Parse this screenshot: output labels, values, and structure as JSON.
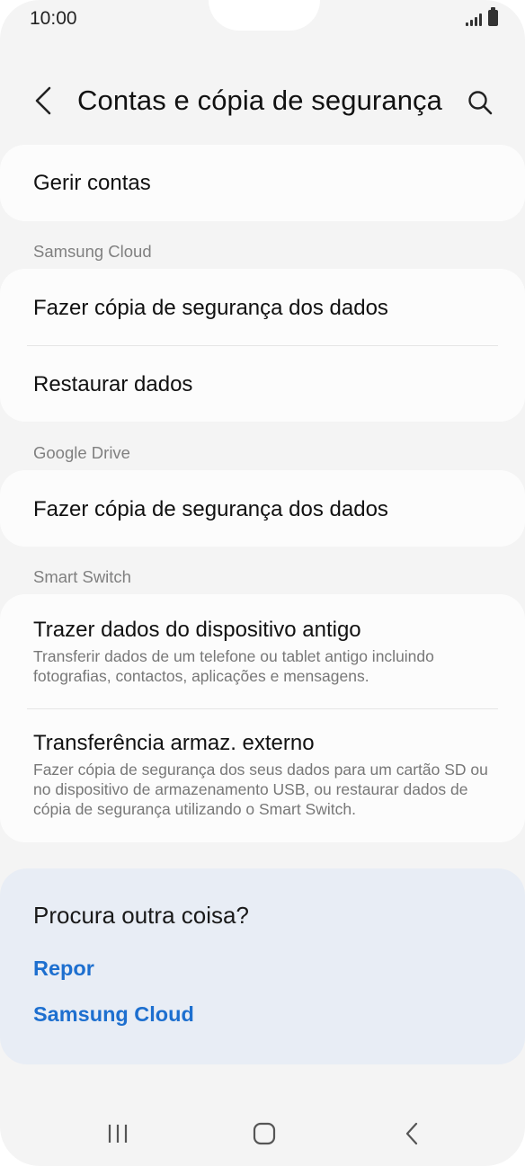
{
  "status_bar": {
    "time": "10:00"
  },
  "header": {
    "title": "Contas e cópia de segurança"
  },
  "accounts": {
    "manage_label": "Gerir contas"
  },
  "samsung_cloud": {
    "header": "Samsung Cloud",
    "items": [
      {
        "label": "Fazer cópia de segurança dos dados"
      },
      {
        "label": "Restaurar dados"
      }
    ]
  },
  "google_drive": {
    "header": "Google Drive",
    "items": [
      {
        "label": "Fazer cópia de segurança dos dados"
      }
    ]
  },
  "smart_switch": {
    "header": "Smart Switch",
    "items": [
      {
        "label": "Trazer dados do dispositivo antigo",
        "description": "Transferir dados de um telefone ou tablet antigo incluindo fotografias, contactos, aplicações e mensagens."
      },
      {
        "label": "Transferência armaz. externo",
        "description": "Fazer cópia de segurança dos seus dados para um cartão SD ou no dispositivo de armazenamento USB, ou restaurar dados de cópia de segurança utilizando o Smart Switch."
      }
    ]
  },
  "suggestions": {
    "title": "Procura outra coisa?",
    "links": [
      {
        "label": "Repor"
      },
      {
        "label": "Samsung Cloud"
      }
    ]
  },
  "colors": {
    "accent_link": "#1d6fcf",
    "background": "#f4f4f4",
    "card": "#fcfcfc",
    "suggest_bg": "#e8edf5"
  }
}
